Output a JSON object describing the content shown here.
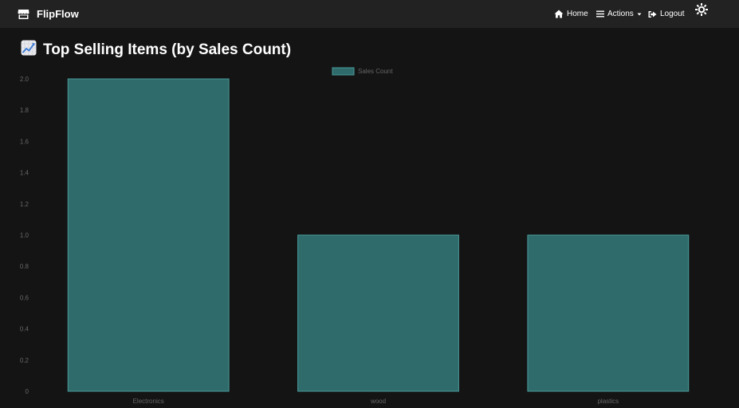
{
  "navbar": {
    "brand": "FlipFlow",
    "brand_icon": "store-icon",
    "items": [
      {
        "label": "Home",
        "icon": "home-icon"
      },
      {
        "label": "Actions",
        "icon": "menu-icon",
        "dropdown": true
      },
      {
        "label": "Logout",
        "icon": "logout-icon"
      }
    ],
    "theme_icon": "sun-icon"
  },
  "page": {
    "heading_icon": "chart-increasing-icon",
    "heading": "Top Selling Items (by Sales Count)"
  },
  "colors": {
    "bar_fill": "#2f6b6b",
    "bar_border": "#4a9a9a",
    "navbar_bg": "#222222",
    "page_bg": "#141414",
    "tick_text": "#666666"
  },
  "chart_data": {
    "type": "bar",
    "categories": [
      "Electronics",
      "wood",
      "plastics"
    ],
    "series": [
      {
        "name": "Sales Count",
        "values": [
          2,
          1,
          1
        ]
      }
    ],
    "ylim": [
      0,
      2.0
    ],
    "yticks": [
      "0",
      "0.2",
      "0.4",
      "0.6",
      "0.8",
      "1.0",
      "1.2",
      "1.4",
      "1.6",
      "1.8",
      "2.0"
    ],
    "legend": "top-center",
    "grid": false,
    "title": "",
    "xlabel": "",
    "ylabel": ""
  }
}
